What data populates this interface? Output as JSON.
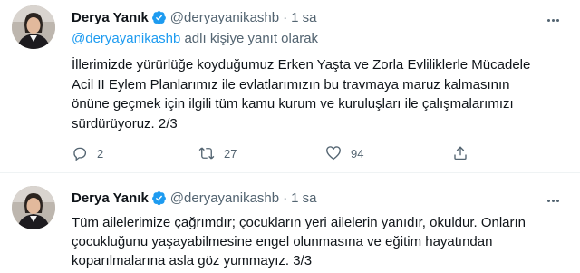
{
  "tweets": [
    {
      "name": "Derya Yanık",
      "handle": "@deryayanikashb",
      "dot": "·",
      "time": "1 sa",
      "reply_mention": "@deryayanikashb",
      "reply_suffix": " adlı kişiye yanıt olarak",
      "text": "İllerimizde yürürlüğe koyduğumuz Erken Yaşta ve Zorla Evliliklerle Mücadele\nAcil II Eylem Planlarımız ile evlatlarımızın bu travmaya maruz kalmasının\nönüne geçmek için ilgili tüm kamu kurum ve kuruluşları ile çalışmalarımızı\nsürdürüyoruz. 2/3",
      "replies": "2",
      "retweets": "27",
      "likes": "94"
    },
    {
      "name": "Derya Yanık",
      "handle": "@deryayanikashb",
      "dot": "·",
      "time": "1 sa",
      "text": "Tüm ailelerimize çağrımdır; çocukların yeri ailelerin yanıdır, okuldur. Onların\nçocukluğunu yaşayabilmesine engel olunmasına ve eğitim hayatından\nkoparılmalarına asla göz yummayız. 3/3"
    }
  ],
  "colors": {
    "accent": "#1d9bf0",
    "secondary_text": "#536471",
    "primary_text": "#0f1419"
  },
  "icons": [
    "verified-badge-icon",
    "more-icon",
    "reply-icon",
    "retweet-icon",
    "like-icon",
    "share-icon"
  ]
}
